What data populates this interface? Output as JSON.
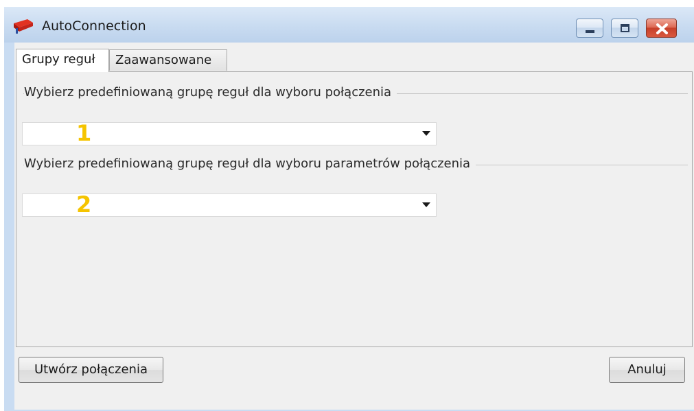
{
  "window": {
    "title": "AutoConnection",
    "icons": {
      "app": "red-connector-app-icon",
      "minimize": "minimize-icon",
      "maximize": "maximize-icon",
      "close": "close-icon"
    }
  },
  "tabs": [
    {
      "label": "Grupy reguł",
      "active": true
    },
    {
      "label": "Zaawansowane",
      "active": false
    }
  ],
  "groups": [
    {
      "label": "Wybierz predefiniowaną grupę reguł dla wyboru połączenia",
      "combo_value": "",
      "marker": "1"
    },
    {
      "label": "Wybierz predefiniowaną grupę reguł dla wyboru parametrów połączenia",
      "combo_value": "",
      "marker": "2"
    }
  ],
  "buttons": {
    "create": "Utwórz połączenia",
    "cancel": "Anuluj"
  },
  "colors": {
    "marker": "#f5c400",
    "close_button": "#c7402a",
    "titlebar": "#c7daf0"
  }
}
